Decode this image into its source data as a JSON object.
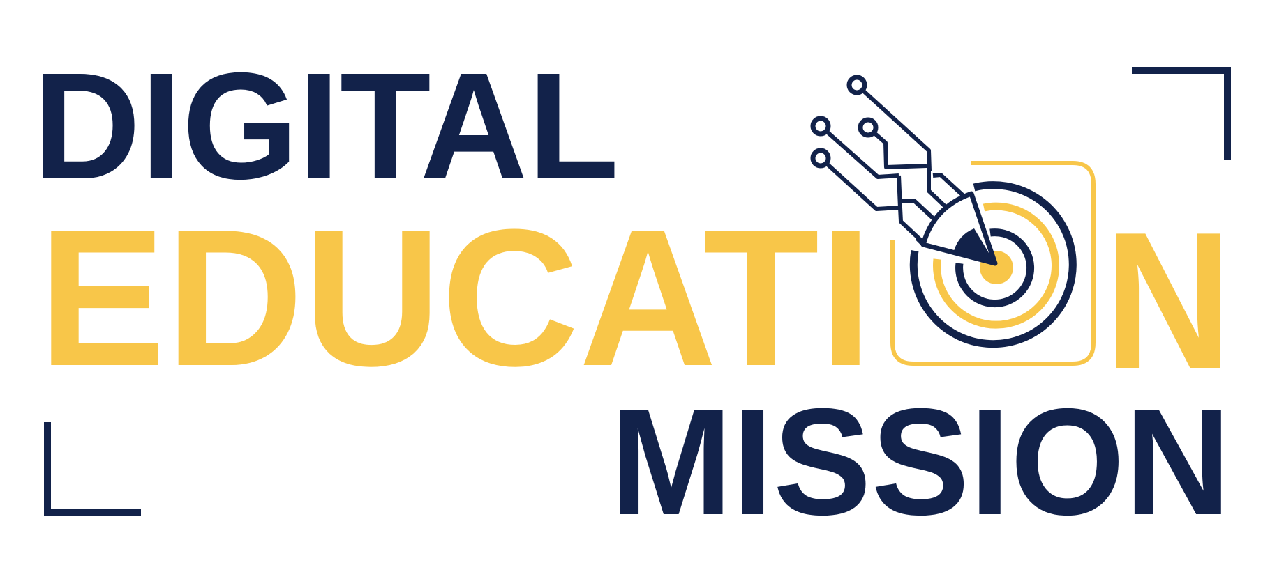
{
  "logo": {
    "line1": "DIGITAL",
    "line2": "EDUCATI",
    "line2_end": "N",
    "line3": "MISSION",
    "colors": {
      "navy": "#12224a",
      "gold": "#f8c649",
      "background": "#ffffff"
    },
    "icon": "target-pen-circuit-icon"
  }
}
